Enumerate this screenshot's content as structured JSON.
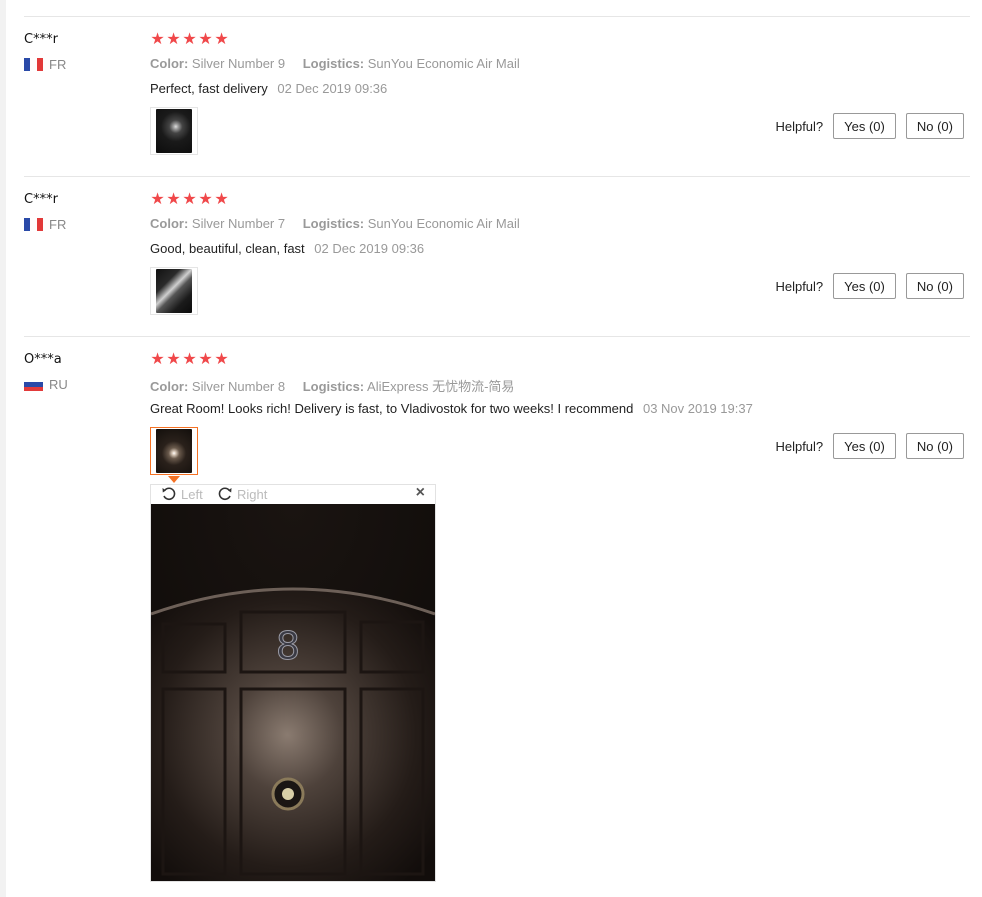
{
  "reviews": [
    {
      "user": "C***r",
      "country": "FR",
      "color_label": "Color:",
      "color_value": "Silver Number 9",
      "logistics_label": "Logistics:",
      "logistics_value": "SunYou Economic Air Mail",
      "text": "Perfect, fast delivery",
      "date": "02 Dec 2019 09:36",
      "rating": 5
    },
    {
      "user": "C***r",
      "country": "FR",
      "color_label": "Color:",
      "color_value": "Silver Number 7",
      "logistics_label": "Logistics:",
      "logistics_value": "SunYou Economic Air Mail",
      "text": "Good, beautiful, clean, fast",
      "date": "02 Dec 2019 09:36",
      "rating": 5
    },
    {
      "user": "O***a",
      "country": "RU",
      "color_label": "Color:",
      "color_value": "Silver Number 8",
      "logistics_label": "Logistics:",
      "logistics_value": "AliExpress 无忧物流-简易",
      "text": "Great Room! Looks rich! Delivery is fast, to Vladivostok for two weeks! I recommend",
      "date": "03 Nov 2019 19:37",
      "rating": 5
    }
  ],
  "helpful": {
    "label": "Helpful?",
    "yes": "Yes (0)",
    "no": "No (0)"
  },
  "viewer": {
    "left": "Left",
    "right": "Right",
    "close": "×",
    "number": "8"
  },
  "colors": {
    "star": "#f0484a",
    "active_border": "#f57224",
    "muted_text": "#999999"
  },
  "icons": {
    "star": "star-icon",
    "rotate_left": "rotate-left-icon",
    "rotate_right": "rotate-right-icon",
    "close": "close-icon"
  }
}
